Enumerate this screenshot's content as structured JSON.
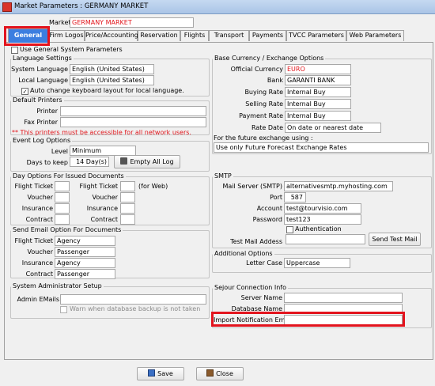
{
  "window": {
    "title": "Market Parameters : GERMANY MARKET"
  },
  "market": {
    "label": "Market",
    "value": "GERMANY MARKET"
  },
  "tabs": [
    "General",
    "Firm Logos",
    "Price/Accounting",
    "Reservation",
    "Flights",
    "Transport",
    "Payments",
    "TVCC Parameters",
    "Web Parameters"
  ],
  "use_general": {
    "label": "Use General System Parameters",
    "checked": false
  },
  "language": {
    "title": "Language Settings",
    "system_label": "System Language",
    "system_value": "English (United States)",
    "local_label": "Local Language",
    "local_value": "English (United States)",
    "auto_label": "Auto change keyboard layout for local language.",
    "auto_checked": true
  },
  "printers": {
    "title": "Default Printers",
    "printer_label": "Printer",
    "fax_label": "Fax Printer",
    "note": "** This printers must be accessible for all network users."
  },
  "event_log": {
    "title": "Event Log Options",
    "level_label": "Level",
    "level_value": "Minimum",
    "days_label": "Days to keep",
    "days_value": "14 Day(s)",
    "empty_btn": "Empty All Log"
  },
  "day_options": {
    "title": "Day Options For Issued Documents",
    "left": [
      "Flight Ticket",
      "Voucher",
      "Insurance",
      "Contract"
    ],
    "right": [
      "Flight Ticket",
      "Voucher",
      "Insurance",
      "Contract"
    ],
    "for_web": "(for Web)"
  },
  "send_email": {
    "title": "Send Email Option For Documents",
    "rows": [
      {
        "label": "Flight Ticket",
        "value": "Agency"
      },
      {
        "label": "Voucher",
        "value": "Passenger"
      },
      {
        "label": "Insurance",
        "value": "Agency"
      },
      {
        "label": "Contract",
        "value": "Passenger"
      }
    ]
  },
  "sysadmin": {
    "title": "System Administrator Setup",
    "admin_label": "Admin EMails",
    "warn_label": "Warn when database backup is not taken"
  },
  "currency": {
    "title": "Base Currency / Exchange Options",
    "rows": [
      {
        "label": "Official Currency",
        "value": "EURO"
      },
      {
        "label": "Bank",
        "value": "GARANTI BANK"
      },
      {
        "label": "Buying Rate",
        "value": "Internal Buy"
      },
      {
        "label": "Selling Rate",
        "value": "Internal Buy"
      },
      {
        "label": "Payment Rate",
        "value": "Internal Buy"
      },
      {
        "label": "Rate Date",
        "value": "On date or nearest date"
      }
    ],
    "future_label": "For the future exchange using :",
    "future_value": "Use only Future Forecast Exchange Rates"
  },
  "smtp": {
    "title": "SMTP",
    "server_label": "Mail Server (SMTP)",
    "server_value": "alternativesmtp.myhosting.com",
    "port_label": "Port",
    "port_value": "587",
    "account_label": "Account",
    "account_value": "test@tourvisio.com",
    "password_label": "Password",
    "password_value": "test123",
    "auth_label": "Authentication",
    "test_label": "Test Mail Addess",
    "test_btn": "Send Test Mail"
  },
  "additional": {
    "title": "Additional Options",
    "letter_label": "Letter Case",
    "letter_value": "Uppercase"
  },
  "sejour": {
    "title": "Sejour Connection Info",
    "server_label": "Server Name",
    "db_label": "Database Name",
    "import_label": "Import Notification Email"
  },
  "footer": {
    "save": "Save",
    "close": "Close"
  },
  "colors": {
    "accent": "#3c7ee0",
    "highlight": "#e3141e"
  }
}
